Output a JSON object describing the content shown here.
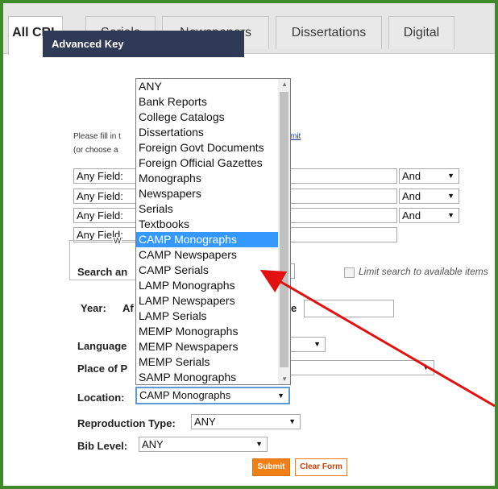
{
  "tabs": [
    "All CRL",
    "Serials",
    "Newspapers",
    "Dissertations",
    "Digital"
  ],
  "header": {
    "title": "Advanced Key"
  },
  "instructions": {
    "line1_prefix": "Please fill in t",
    "line1_link": "mit",
    "line2": "(or choose a"
  },
  "field_rows": [
    {
      "field": "Any Field:",
      "op": "And"
    },
    {
      "field": "Any Field:",
      "op": "And"
    },
    {
      "field": "Any Field:",
      "op": "And"
    },
    {
      "field": "Any Field:",
      "op": ""
    }
  ],
  "search_label": "Search an",
  "limit_label": "Limit search to available items",
  "year": {
    "label": "Year:",
    "legend_fragment": "W",
    "after_fragment": "Af",
    "before_fragment": "ore"
  },
  "labels": {
    "language": "Language",
    "place": "Place of P",
    "location": "Location:",
    "reproduction": "Reproduction Type:",
    "biblevel": "Bib Level:"
  },
  "selects": {
    "location": "CAMP Monographs",
    "reproduction": "ANY",
    "biblevel": "ANY"
  },
  "buttons": {
    "submit": "Submit",
    "clear": "Clear Form"
  },
  "dropdown": {
    "options": [
      "ANY",
      "Bank Reports",
      "College Catalogs",
      "Dissertations",
      "Foreign Govt Documents",
      "Foreign Official Gazettes",
      "Monographs",
      "Newspapers",
      "Serials",
      "Textbooks",
      "CAMP Monographs",
      "CAMP Newspapers",
      "CAMP Serials",
      "LAMP Monographs",
      "LAMP Newspapers",
      "LAMP Serials",
      "MEMP Monographs",
      "MEMP Newspapers",
      "MEMP Serials",
      "SAMP Monographs"
    ],
    "selected": "CAMP Monographs"
  },
  "colors": {
    "frame": "#3e8a2a",
    "header": "#2e3a56",
    "selected": "#3399ff",
    "submit": "#f07f16",
    "arrow": "#e21010"
  }
}
